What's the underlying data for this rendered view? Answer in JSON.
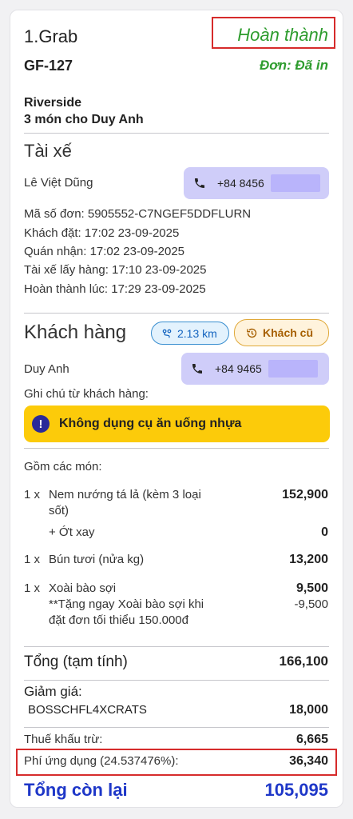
{
  "order": {
    "title": "1.Grab",
    "status": "Hoàn thành",
    "code": "GF-127",
    "print_status": "Đơn: Đã in",
    "store": "Riverside",
    "items_summary": "3 món cho Duy Anh"
  },
  "driver": {
    "section_title": "Tài xế",
    "name": "Lê Việt Dũng",
    "phone": "+84 8456",
    "details": [
      "Mã số đơn: 5905552-C7NGEF5DDFLURN",
      "Khách đặt: 17:02 23-09-2025",
      "Quán nhận: 17:02 23-09-2025",
      "Tài xế lấy hàng: 17:10 23-09-2025",
      "Hoàn thành lúc: 17:29 23-09-2025"
    ]
  },
  "customer": {
    "section_title": "Khách hàng",
    "distance": "2.13 km",
    "tag": "Khách cũ",
    "name": "Duy Anh",
    "phone": "+84 9465",
    "note_label": "Ghi chú từ khách hàng:",
    "note": "Không dụng cụ ăn uống nhựa"
  },
  "items": {
    "header": "Gồm các món:",
    "lines": [
      {
        "qty": "1 x",
        "name1": "Nem nướng tá lả (kèm 3 loại",
        "name2": "sốt)",
        "price": "152,900"
      },
      {
        "option": "+ Ớt xay",
        "price": "0"
      },
      {
        "qty": "1 x",
        "name1": "Bún tươi (nửa kg)",
        "price": "13,200"
      },
      {
        "qty": "1 x",
        "name1": "Xoài bào sợi",
        "price": "9,500"
      },
      {
        "promo1": "**Tặng ngay Xoài bào sợi khi",
        "promo2": "đặt đơn tối thiểu 150.000đ",
        "price": "-9,500"
      }
    ]
  },
  "totals": {
    "subtotal_label": "Tổng (tạm tính)",
    "subtotal": "166,100",
    "discount_label": "Giảm giá:",
    "discount_code": "BOSSCHFL4XCRATS",
    "discount": "18,000",
    "tax_label": "Thuế khấu trừ:",
    "tax": "6,665",
    "fee_label": "Phí ứng dụng (24.537476%):",
    "fee": "36,340",
    "remaining_label": "Tổng còn lại",
    "remaining": "105,095"
  },
  "colors": {
    "green": "#2e9c2e",
    "blue": "#1e37c8",
    "highlight_red": "#d62b2b",
    "note_yellow": "#fccb0a",
    "phone_purple": "#cfcdf9"
  }
}
